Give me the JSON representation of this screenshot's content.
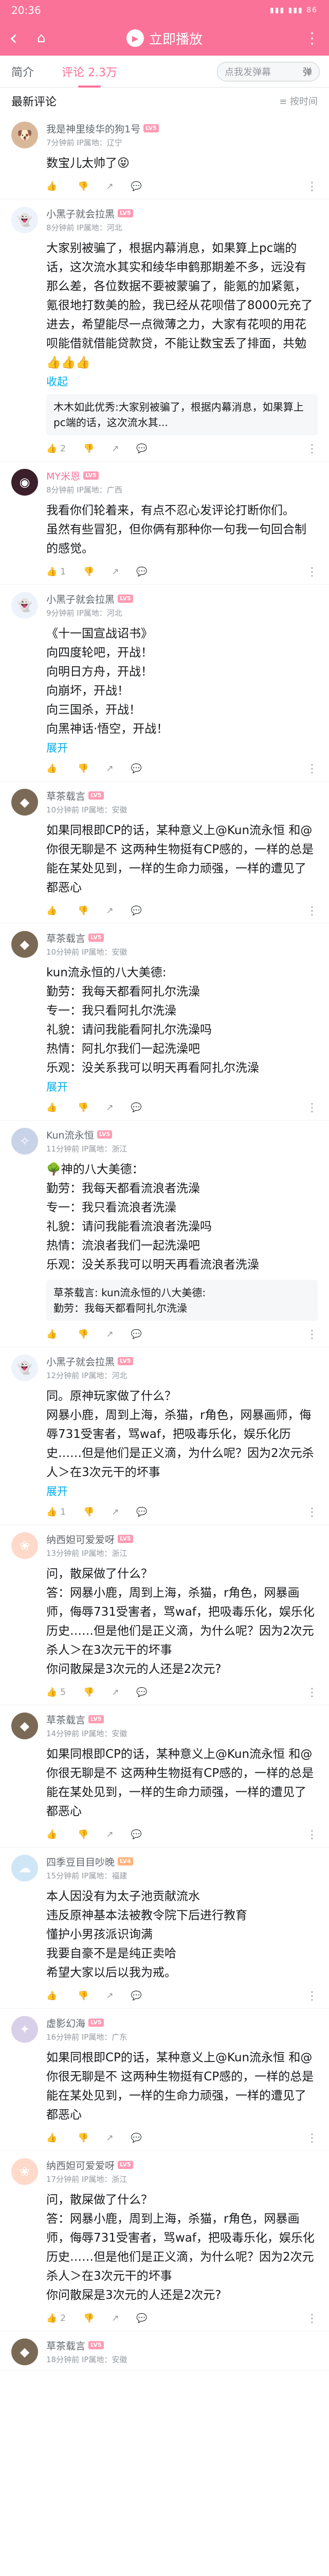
{
  "status": {
    "time": "20:36",
    "indicators": "▮▮▮ ▮▮▮ 86"
  },
  "topbar": {
    "back": "‹",
    "home": "⌂",
    "play_label": "立即播放",
    "more": "⋮"
  },
  "tabs": [
    {
      "label": "简介"
    },
    {
      "label": "评论 2.3万"
    }
  ],
  "danmu": {
    "placeholder": "点我发弹幕",
    "icon": "弹"
  },
  "subhead": {
    "title": "最新评论",
    "sort": "≡ 按时间"
  },
  "comments": [
    {
      "name": "我是神里绫华的狗1号",
      "vip": false,
      "lv": "LV5",
      "lvcolor": "#ff9bb3",
      "meta": "7分钟前 IP属地：辽宁",
      "text": "数宝儿太帅了😝",
      "expand": "",
      "likes": "",
      "avatar_color": "#d9b89a",
      "avatar_glyph": "🐶",
      "reply": "",
      "lines": 1
    },
    {
      "name": "小黑子就会拉黑",
      "vip": false,
      "lv": "LV5",
      "lvcolor": "#ff9bb3",
      "meta": "8分钟前 IP属地：河北",
      "text": "大家别被骗了，根据内幕消息，如果算上pc端的话，这次流水其实和绫华申鹤那期差不多，远没有那么差，各位数据不要被蒙骗了，能氪的加紧氪，氪很地打数美的脸，我已经从花呗借了8000元充了进去，希望能尽一点微薄之力，大家有花呗的用花呗能借就借能贷款贷，不能让数宝丢了排面，共勉\n👍👍👍",
      "expand": "收起",
      "likes": "2",
      "avatar_color": "#eef3fb",
      "avatar_glyph": "👻",
      "reply": "木木如此优秀:大家别被骗了，根据内幕消息，如果算上pc端的话，这次流水其...",
      "lines": 8
    },
    {
      "name": "MY米恩",
      "vip": true,
      "lv": "LV5",
      "lvcolor": "#ff9bb3",
      "meta": "8分钟前 IP属地：广西",
      "text": "我看你们轮着来，有点不忍心发评论打断你们。\n虽然有些冒犯，但你俩有那种你一句我一句回合制的感觉。",
      "expand": "",
      "likes": "1",
      "avatar_color": "#3b1f2a",
      "avatar_glyph": "◉",
      "reply": "",
      "lines": 4
    },
    {
      "name": "小黑子就会拉黑",
      "vip": false,
      "lv": "LV5",
      "lvcolor": "#ff9bb3",
      "meta": "9分钟前 IP属地：河北",
      "text": "《十一国宣战诏书》\n向四度轮吧，开战！\n向明日方舟，开战！\n向崩坏，开战！\n向三国杀，开战！\n向黑神话·悟空，开战！",
      "expand": "展开",
      "likes": "",
      "avatar_color": "#eef3fb",
      "avatar_glyph": "👻",
      "reply": "",
      "lines": 6
    },
    {
      "name": "草茶载言",
      "vip": false,
      "lv": "LV5",
      "lvcolor": "#ff9bb3",
      "meta": "10分钟前 IP属地：安徽",
      "text": "如果同根即CP的话，某种意义上@Kun流永恒 和@你很无聊是不 这两种生物挺有CP感的，一样的总是能在某处见到，一样的生命力顽强，一样的遭见了都恶心",
      "expand": "",
      "likes": "",
      "avatar_color": "#7a6a55",
      "avatar_glyph": "◆",
      "reply": "",
      "lines": 4
    },
    {
      "name": "草茶载言",
      "vip": false,
      "lv": "LV5",
      "lvcolor": "#ff9bb3",
      "meta": "10分钟前 IP属地：安徽",
      "text": "kun流永恒的八大美德:\n勤劳：我每天都看阿扎尔洗澡\n专一：我只看阿扎尔洗澡\n礼貌：请问我能看阿扎尔洗澡吗\n热情：阿扎尔我们一起洗澡吧\n乐观：没关系我可以明天再看阿扎尔洗澡",
      "expand": "展开",
      "likes": "",
      "avatar_color": "#7a6a55",
      "avatar_glyph": "◆",
      "reply": "",
      "lines": 6
    },
    {
      "name": "Kun流永恒",
      "vip": false,
      "lv": "LV5",
      "lvcolor": "#ff9bb3",
      "meta": "11分钟前 IP属地：浙江",
      "text": "🌳神的八大美德：\n勤劳：我每天都看流浪者洗澡\n专一：我只看流浪者洗澡\n礼貌：请问我能看流浪者洗澡吗\n热情：流浪者我们一起洗澡吧\n乐观：没关系我可以明天再看流浪者洗澡",
      "expand": "",
      "likes": "",
      "avatar_color": "#c9d3e8",
      "avatar_glyph": "✧",
      "reply": "草茶载言: kun流永恒的八大美德:\n勤劳：我每天都看阿扎尔洗澡",
      "lines": 6
    },
    {
      "name": "小黑子就会拉黑",
      "vip": false,
      "lv": "LV5",
      "lvcolor": "#ff9bb3",
      "meta": "12分钟前 IP属地：河北",
      "text": "同。原神玩家做了什么？\n网暴小鹿，周到上海，杀猫，r角色，网暴画师，侮辱731受害者，骂waf，把吸毒乐化，娱乐化历史……但是他们是正义滴，为什么呢？因为2次元杀人＞在3次元干的坏事",
      "expand": "展开",
      "likes": "1",
      "avatar_color": "#eef3fb",
      "avatar_glyph": "👻",
      "reply": "",
      "lines": 6
    },
    {
      "name": "纳西妲可爱爱呀",
      "vip": false,
      "lv": "LV5",
      "lvcolor": "#ff9bb3",
      "meta": "13分钟前 IP属地：浙江",
      "text": "问，散屎做了什么？\n答：网暴小鹿，周到上海，杀猫，r角色，网暴画师，侮辱731受害者，骂waf，把吸毒乐化，娱乐化历史……但是他们是正义滴，为什么呢？因为2次元杀人＞在3次元干的坏事\n你问散屎是3次元的人还是2次元?",
      "expand": "",
      "likes": "5",
      "avatar_color": "#ffd9c9",
      "avatar_glyph": "❀",
      "reply": "",
      "lines": 7
    },
    {
      "name": "草茶载言",
      "vip": false,
      "lv": "LV5",
      "lvcolor": "#ff9bb3",
      "meta": "14分钟前 IP属地：安徽",
      "text": "如果同根即CP的话，某种意义上@Kun流永恒 和@你很无聊是不 这两种生物挺有CP感的，一样的总是能在某处见到，一样的生命力顽强，一样的遭见了都恶心",
      "expand": "",
      "likes": "",
      "avatar_color": "#7a6a55",
      "avatar_glyph": "◆",
      "reply": "",
      "lines": 4
    },
    {
      "name": "四季豆目目吵晚",
      "vip": false,
      "lv": "LV4",
      "lvcolor": "#ffb37c",
      "meta": "15分钟前 IP属地：福建",
      "text": "本人因没有为太子池贡献流水\n违反原神基本法被教令院下后进行教育\n懂护小男孩派识询满\n我要自豪不是是纯正卖哈\n希望大家以后以我为戒。",
      "expand": "",
      "likes": "",
      "avatar_color": "#cfe6f7",
      "avatar_glyph": "☁",
      "reply": "",
      "lines": 5
    },
    {
      "name": "虚影幻海",
      "vip": false,
      "lv": "LV5",
      "lvcolor": "#ff9bb3",
      "meta": "16分钟前 IP属地：广东",
      "text": "如果同根即CP的话，某种意义上@Kun流永恒 和@你很无聊是不 这两种生物挺有CP感的，一样的总是能在某处见到，一样的生命力顽强，一样的遭见了都恶心",
      "expand": "",
      "likes": "",
      "avatar_color": "#d8d0e8",
      "avatar_glyph": "✦",
      "reply": "",
      "lines": 4
    },
    {
      "name": "纳西妲可爱爱呀",
      "vip": false,
      "lv": "LV5",
      "lvcolor": "#ff9bb3",
      "meta": "17分钟前 IP属地：浙江",
      "text": "问，散屎做了什么？\n答：网暴小鹿，周到上海，杀猫，r角色，网暴画师，侮辱731受害者，骂waf，把吸毒乐化，娱乐化历史……但是他们是正义滴，为什么呢？因为2次元杀人＞在3次元干的坏事\n你问散屎是3次元的人还是2次元?",
      "expand": "",
      "likes": "2",
      "avatar_color": "#ffd9c9",
      "avatar_glyph": "❀",
      "reply": "",
      "lines": 7
    },
    {
      "name": "草茶载言",
      "vip": false,
      "lv": "LV5",
      "lvcolor": "#ff9bb3",
      "meta": "18分钟前 IP属地：安徽",
      "text": "",
      "expand": "",
      "likes": "",
      "avatar_color": "#7a6a55",
      "avatar_glyph": "◆",
      "reply": "",
      "lines": 0
    }
  ]
}
